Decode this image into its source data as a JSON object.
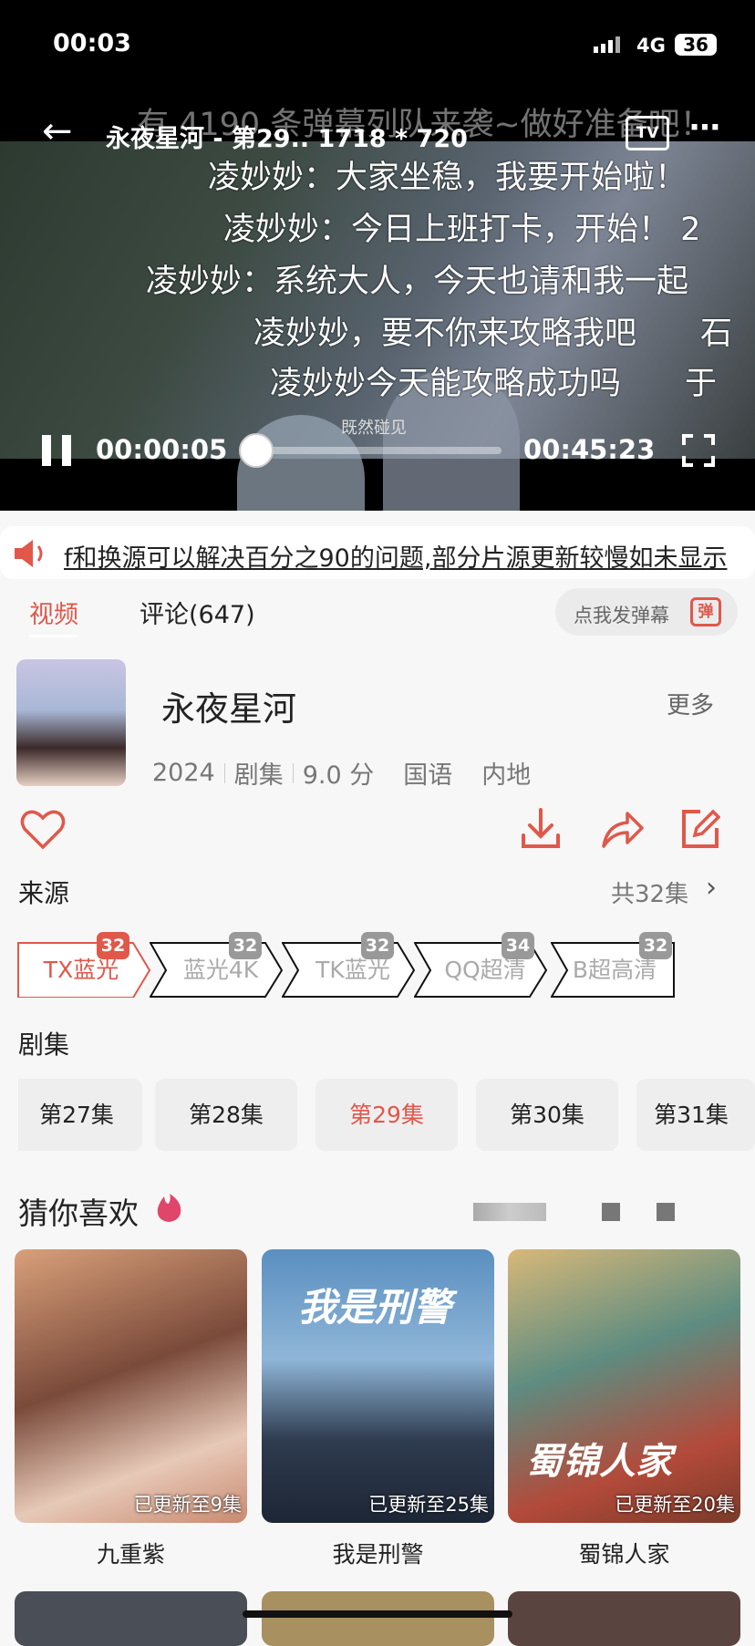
{
  "status_bar": {
    "time": "00:03",
    "network": "4G",
    "battery": "36"
  },
  "player": {
    "title": "永夜星河 - 第29.. 1718 * 720",
    "danmaku_notice": "有 4190 条弹幕列队来袭~做好准备吧！",
    "danmaku": [
      "凌妙妙：大家坐稳，我要开始啦！",
      "凌妙妙：今日上班打卡，开始！ 2",
      "凌妙妙：系统大人，今天也请和我一起",
      "凌妙妙，要不你来攻略我吧　　石",
      "凌妙妙今天能攻略成功吗　　于"
    ],
    "subtitle": "既然碰见",
    "current_time": "00:00:05",
    "duration": "00:45:23",
    "progress_fraction": 0.002,
    "tv_label": "TV"
  },
  "notice": {
    "text": "f和换源可以解决百分之90的问题,部分片源更新较慢如未显示"
  },
  "tabs": [
    {
      "label": "视频",
      "active": true
    },
    {
      "label": "评论(647)",
      "active": false
    }
  ],
  "danmaku_button": {
    "label": "点我发弹幕",
    "icon_label": "弹"
  },
  "show": {
    "title": "永夜星河",
    "more": "更多",
    "year": "2024",
    "type": "剧集",
    "score": "9.0 分",
    "language": "国语",
    "region": "内地"
  },
  "sources": {
    "heading": "来源",
    "total": "共32集",
    "items": [
      {
        "label": "TX蓝光",
        "count": "32",
        "active": true
      },
      {
        "label": "蓝光4K",
        "count": "32"
      },
      {
        "label": "TK蓝光",
        "count": "32"
      },
      {
        "label": "QQ超清",
        "count": "34"
      },
      {
        "label": "B超高清",
        "count": "32"
      }
    ]
  },
  "episodes": {
    "heading": "剧集",
    "items": [
      {
        "label": "第27集"
      },
      {
        "label": "第28集"
      },
      {
        "label": "第29集",
        "active": true
      },
      {
        "label": "第30集"
      },
      {
        "label": "第31集"
      }
    ]
  },
  "recommend": {
    "heading": "猜你喜欢",
    "items": [
      {
        "title": "九重紫",
        "update": "已更新至9集"
      },
      {
        "title": "我是刑警",
        "update": "已更新至25集",
        "poster_text": "我是刑警"
      },
      {
        "title": "蜀锦人家",
        "update": "已更新至20集",
        "poster_text": "蜀锦人家"
      }
    ]
  },
  "colors": {
    "accent": "#e0584a",
    "player_bg": "#000000",
    "page_bg": "#f7f7f7"
  }
}
